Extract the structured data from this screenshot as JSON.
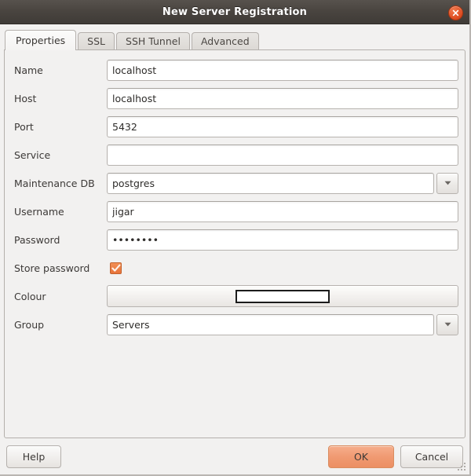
{
  "window": {
    "title": "New Server Registration",
    "close_icon": "close-icon"
  },
  "tabs": [
    {
      "label": "Properties",
      "active": true
    },
    {
      "label": "SSL",
      "active": false
    },
    {
      "label": "SSH Tunnel",
      "active": false
    },
    {
      "label": "Advanced",
      "active": false
    }
  ],
  "form": {
    "name": {
      "label": "Name",
      "value": "localhost",
      "placeholder": ""
    },
    "host": {
      "label": "Host",
      "value": "localhost",
      "placeholder": ""
    },
    "port": {
      "label": "Port",
      "value": "5432",
      "placeholder": ""
    },
    "service": {
      "label": "Service",
      "value": "",
      "placeholder": ""
    },
    "maintenance_db": {
      "label": "Maintenance DB",
      "value": "postgres",
      "placeholder": "",
      "arrow_icon": "chevron-down-icon"
    },
    "username": {
      "label": "Username",
      "value": "jigar",
      "placeholder": ""
    },
    "password": {
      "label": "Password",
      "value": "••••••••",
      "placeholder": ""
    },
    "store_password": {
      "label": "Store password",
      "checked": true,
      "check_icon": "check-icon"
    },
    "colour": {
      "label": "Colour",
      "swatch_hex": "#ffffff"
    },
    "group": {
      "label": "Group",
      "value": "Servers",
      "placeholder": "",
      "arrow_icon": "chevron-down-icon"
    }
  },
  "actions": {
    "help_label": "Help",
    "ok_label": "OK",
    "cancel_label": "Cancel"
  },
  "colors": {
    "accent": "#ec8f63",
    "titlebar": "#4a4540",
    "checkbox": "#e8733a"
  }
}
